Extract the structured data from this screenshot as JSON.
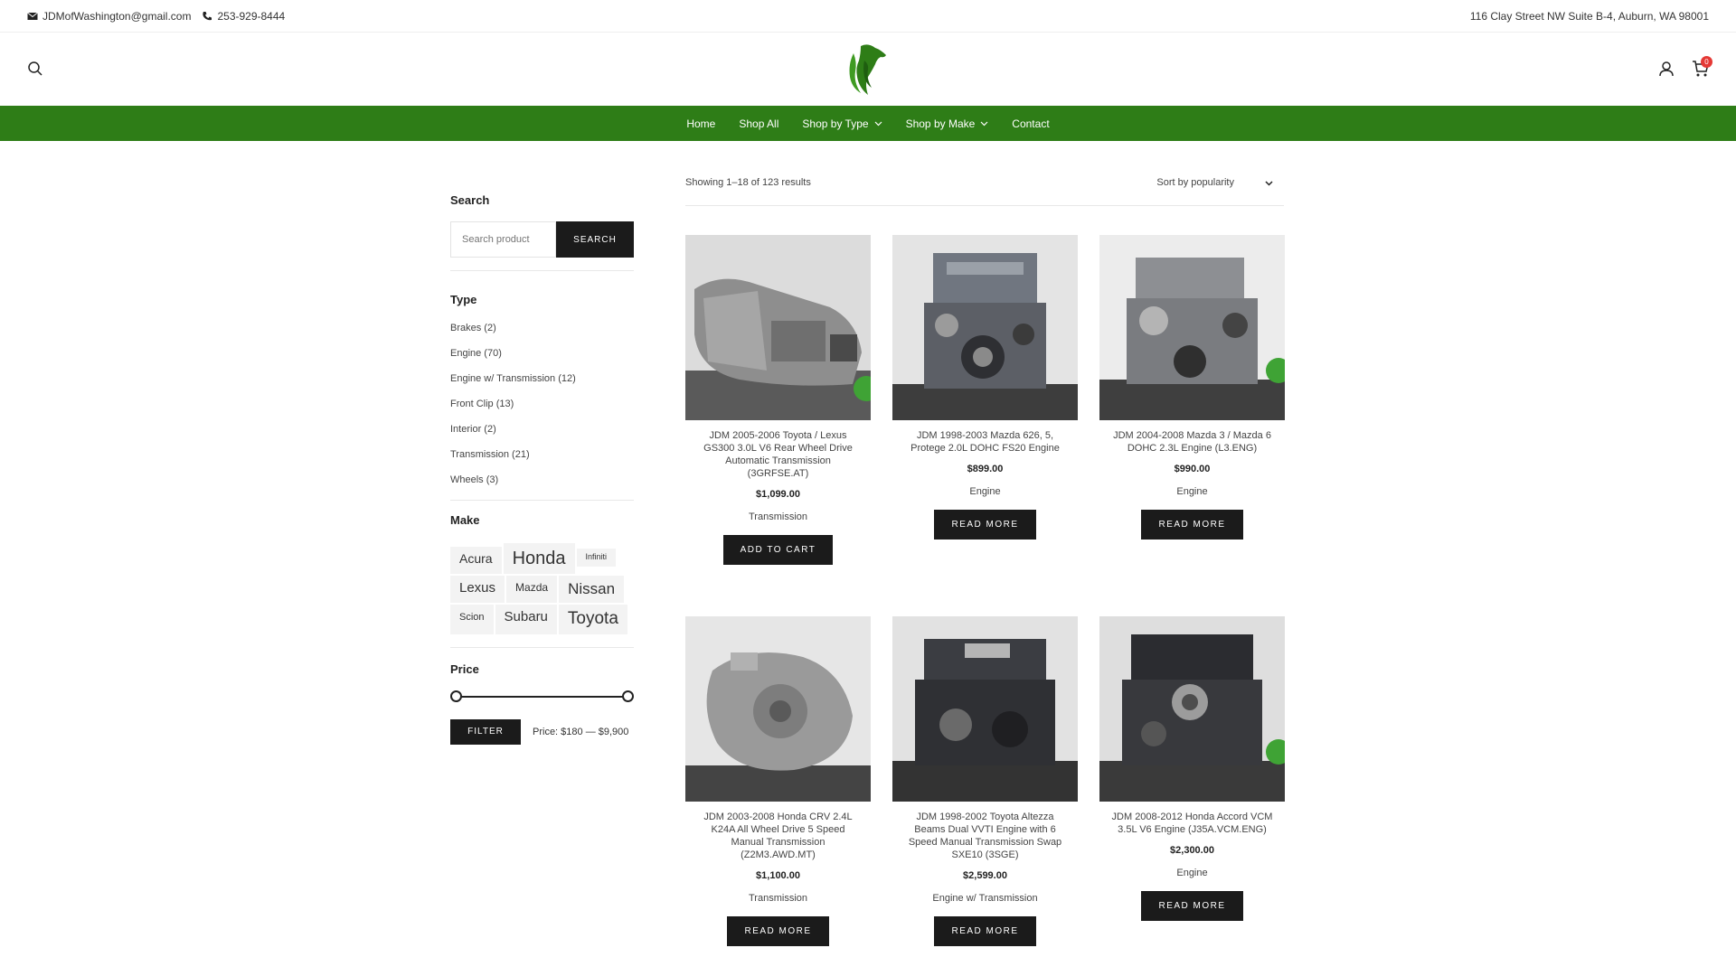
{
  "topbar": {
    "email": "JDMofWashington@gmail.com",
    "phone": "253-929-8444",
    "address": "116 Clay Street NW Suite B-4, Auburn, WA 98001"
  },
  "header": {
    "cart_count": "0",
    "brand_color": "#2e7d17"
  },
  "nav": {
    "items": [
      "Home",
      "Shop All",
      "Shop by Type",
      "Shop by Make",
      "Contact"
    ]
  },
  "sidebar": {
    "search": {
      "title": "Search",
      "placeholder": "Search product",
      "button": "SEARCH"
    },
    "type": {
      "title": "Type",
      "items": [
        "Brakes (2)",
        "Engine (70)",
        "Engine w/ Transmission (12)",
        "Front Clip (13)",
        "Interior (2)",
        "Transmission (21)",
        "Wheels (3)"
      ]
    },
    "make": {
      "title": "Make",
      "tags": [
        "Acura",
        "Honda",
        "Infiniti",
        "Lexus",
        "Mazda",
        "Nissan",
        "Scion",
        "Subaru",
        "Toyota"
      ]
    },
    "price": {
      "title": "Price",
      "button": "FILTER",
      "label": "Price: $180 — $9,900",
      "range_fraction": [
        0,
        1
      ]
    }
  },
  "main": {
    "result_count": "Showing 1–18 of 123 results",
    "sort_label": "Sort by popularity",
    "products": [
      {
        "title": "JDM 2005-2006 Toyota / Lexus GS300 3.0L V6 Rear Wheel Drive Automatic Transmission (3GRFSE.AT)",
        "price": "$1,099.00",
        "category": "Transmission",
        "button": "ADD TO CART"
      },
      {
        "title": "JDM 1998-2003 Mazda 626, 5, Protege 2.0L DOHC FS20 Engine",
        "price": "$899.00",
        "category": "Engine",
        "button": "READ MORE"
      },
      {
        "title": "JDM 2004-2008 Mazda 3 / Mazda 6 DOHC 2.3L Engine (L3.ENG)",
        "price": "$990.00",
        "category": "Engine",
        "button": "READ MORE"
      },
      {
        "title": "JDM 2003-2008 Honda CRV 2.4L K24A All Wheel Drive 5 Speed Manual Transmission (Z2M3.AWD.MT)",
        "price": "$1,100.00",
        "category": "Transmission",
        "button": "READ MORE"
      },
      {
        "title": "JDM 1998-2002 Toyota Altezza Beams Dual VVTI Engine with 6 Speed Manual Transmission Swap SXE10 (3SGE)",
        "price": "$2,599.00",
        "category": "Engine w/ Transmission",
        "button": "READ MORE"
      },
      {
        "title": "JDM 2008-2012 Honda Accord VCM 3.5L V6 Engine (J35A.VCM.ENG)",
        "price": "$2,300.00",
        "category": "Engine",
        "button": "READ MORE"
      }
    ]
  }
}
